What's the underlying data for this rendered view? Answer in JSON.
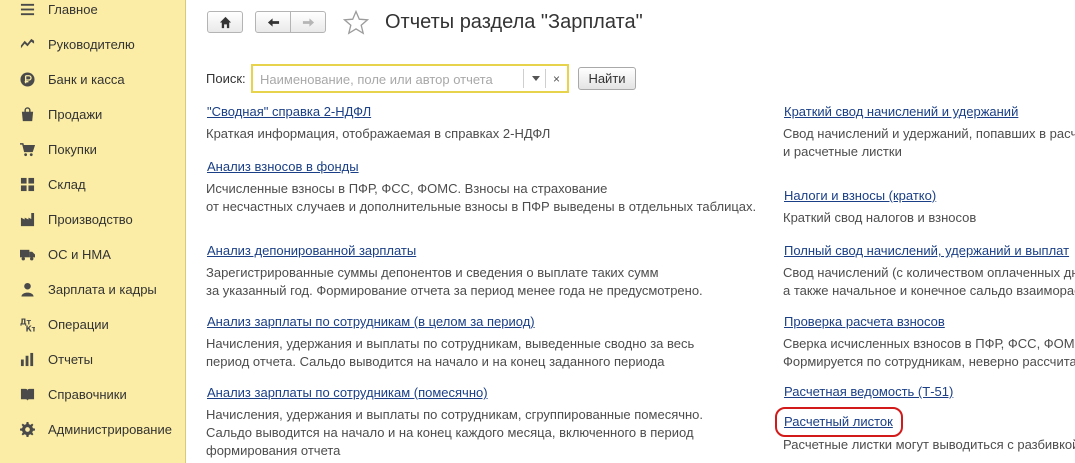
{
  "sidebar": {
    "items": [
      {
        "label": "Главное",
        "icon": "menu-lines-icon"
      },
      {
        "label": "Руководителю",
        "icon": "trend-chart-icon"
      },
      {
        "label": "Банк и касса",
        "icon": "ruble-coin-icon"
      },
      {
        "label": "Продажи",
        "icon": "shopping-bag-icon"
      },
      {
        "label": "Покупки",
        "icon": "shopping-cart-icon"
      },
      {
        "label": "Склад",
        "icon": "warehouse-grid-icon"
      },
      {
        "label": "Производство",
        "icon": "factory-icon"
      },
      {
        "label": "ОС и НМА",
        "icon": "truck-icon"
      },
      {
        "label": "Зарплата и кадры",
        "icon": "person-icon"
      },
      {
        "label": "Операции",
        "icon": "dt-kt-icon"
      },
      {
        "label": "Отчеты",
        "icon": "bar-chart-icon"
      },
      {
        "label": "Справочники",
        "icon": "book-icon"
      },
      {
        "label": "Администрирование",
        "icon": "gear-icon"
      }
    ]
  },
  "header": {
    "title": "Отчеты раздела \"Зарплата\""
  },
  "search": {
    "label": "Поиск:",
    "placeholder": "Наименование, поле или автор отчета",
    "value": "",
    "clear_glyph": "×",
    "find_label": "Найти"
  },
  "reports_left": [
    {
      "title": "\"Сводная\" справка 2-НДФЛ",
      "desc": "Краткая информация, отображаемая в справках 2-НДФЛ"
    },
    {
      "title": "Анализ взносов в фонды",
      "desc": "Исчисленные взносы в ПФР, ФСС, ФОМС. Взносы на страхование\nот несчастных случаев и дополнительные взносы в ПФР выведены в отдельных таблицах."
    },
    {
      "title": "Анализ депонированной зарплаты",
      "desc": "Зарегистрированные суммы депонентов и сведения о выплате таких сумм\nза указанный год. Формирование отчета за период менее года не предусмотрено."
    },
    {
      "title": "Анализ зарплаты по сотрудникам (в целом за период)",
      "desc": "Начисления, удержания и выплаты по сотрудникам, выведенные сводно за весь\nпериод отчета. Сальдо выводится на начало и на конец заданного периода"
    },
    {
      "title": "Анализ зарплаты по сотрудникам (помесячно)",
      "desc": "Начисления, удержания и выплаты по сотрудникам, сгруппированные помесячно.\nСальдо выводится на начало и на конец каждого месяца, включенного в период\nформирования отчета"
    }
  ],
  "reports_right": [
    {
      "title": "Краткий свод начислений и удержаний",
      "desc": "Свод начислений и удержаний, попавших в расчетные листки\nи расчетные листки"
    },
    {
      "title": "Налоги и взносы (кратко)",
      "desc": "Краткий свод налогов и взносов"
    },
    {
      "title": "Полный свод начислений, удержаний и выплат",
      "desc": "Свод начислений (с количеством оплаченных дней и часов)\nа также начальное и конечное сальдо взаиморасчетов"
    },
    {
      "title": "Проверка расчета взносов",
      "desc": "Сверка исчисленных взносов в ПФР, ФСС, ФОМС\nФормируется по сотрудникам, неверно рассчитанным"
    },
    {
      "title": "Расчетная ведомость (Т-51)",
      "desc": ""
    },
    {
      "title": "Расчетный листок",
      "desc": "Расчетные листки могут выводиться с разбивкой"
    }
  ]
}
